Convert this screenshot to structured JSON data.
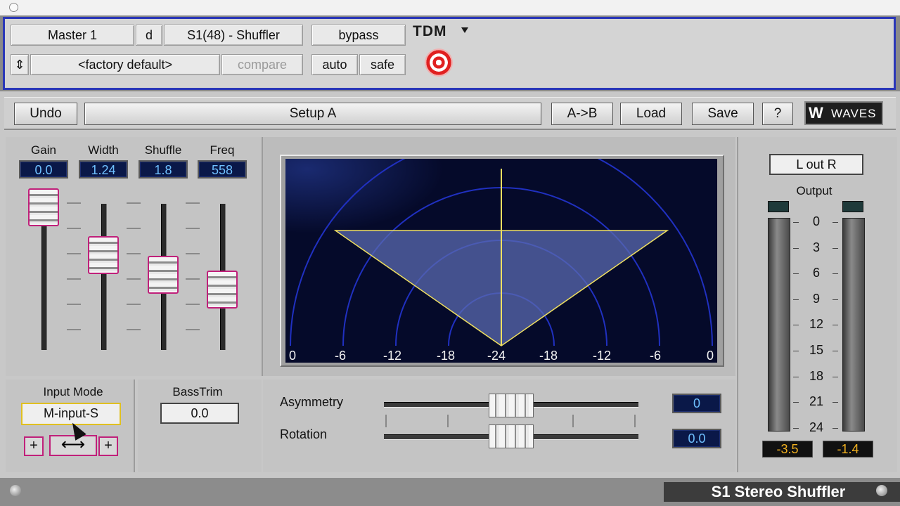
{
  "host": {
    "track": "Master 1",
    "insert": "d",
    "plugin": "S1(48) - Shuffler",
    "bypass": "bypass",
    "preset_arrows": "⇕",
    "preset": "<factory default>",
    "compare": "compare",
    "auto": "auto",
    "safe": "safe",
    "format": "TDM"
  },
  "toolbar": {
    "undo": "Undo",
    "setup": "Setup A",
    "ab": "A->B",
    "load": "Load",
    "save": "Save",
    "help": "?",
    "brand": "WAVES"
  },
  "faders": [
    {
      "label": "Gain",
      "value": "0.0",
      "position": 0.97
    },
    {
      "label": "Width",
      "value": "1.24",
      "position": 0.62
    },
    {
      "label": "Shuffle",
      "value": "1.8",
      "position": 0.48
    },
    {
      "label": "Freq",
      "value": "558",
      "position": 0.37
    }
  ],
  "input_mode": {
    "label": "Input Mode",
    "value": "M-input-S",
    "plus": "+",
    "arrow": "⟷"
  },
  "bass_trim": {
    "label": "BassTrim",
    "value": "0.0"
  },
  "scope": {
    "scale_labels": [
      "0",
      "-6",
      "-12",
      "-18",
      "-24",
      "-18",
      "-12",
      "-6",
      "0"
    ],
    "colors": {
      "background": "#050a2a",
      "rings": "#2030c0",
      "image": "#f0e060",
      "fill": "#5a6ab0"
    }
  },
  "asymmetry": {
    "label": "Asymmetry",
    "value": "0",
    "position": 0.5
  },
  "rotation": {
    "label": "Rotation",
    "value": "0.0",
    "position": 0.5
  },
  "output": {
    "lr": "L  out  R",
    "label": "Output",
    "scale": [
      "0",
      "3",
      "6",
      "9",
      "12",
      "15",
      "18",
      "21",
      "24"
    ],
    "left_value": "-3.5",
    "right_value": "-1.4"
  },
  "footer": {
    "title": "S1 Stereo Shuffler"
  }
}
